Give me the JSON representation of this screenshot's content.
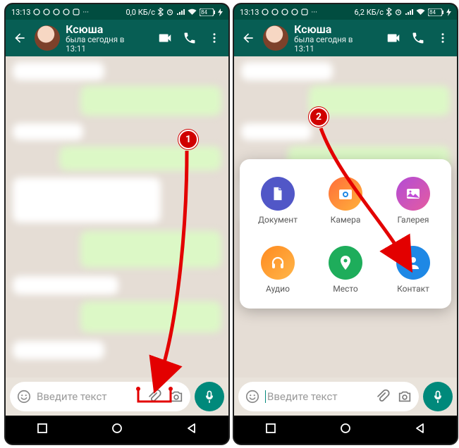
{
  "status_left": {
    "time": "13:13"
  },
  "status_right_left": {
    "data": "0,0 КБ/с"
  },
  "status_right_right": {
    "data": "6,2 КБ/с"
  },
  "battery": {
    "value": "84"
  },
  "header": {
    "name": "Ксюша",
    "presence": "была сегодня в 13:11"
  },
  "composer": {
    "placeholder": "Введите текст"
  },
  "attach": {
    "document": "Документ",
    "camera": "Камера",
    "gallery": "Галерея",
    "audio": "Аудио",
    "location": "Место",
    "contact": "Контакт"
  },
  "steps": {
    "one": "1",
    "two": "2"
  }
}
